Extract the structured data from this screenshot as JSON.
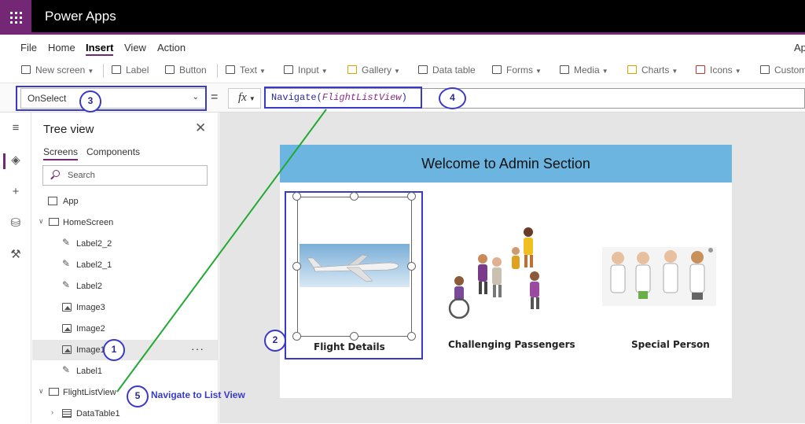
{
  "app": {
    "title": "Power Apps"
  },
  "menu": {
    "items": [
      "File",
      "Home",
      "Insert",
      "View",
      "Action"
    ],
    "active": "Insert",
    "right_label": "Ap"
  },
  "ribbon": {
    "new_screen": "New screen",
    "label": "Label",
    "button": "Button",
    "text": "Text",
    "input": "Input",
    "gallery": "Gallery",
    "data_table": "Data table",
    "forms": "Forms",
    "media": "Media",
    "charts": "Charts",
    "icons": "Icons",
    "custom": "Custom"
  },
  "formula_bar": {
    "property": "OnSelect",
    "equals": "=",
    "fx": "fx",
    "function_name": "Navigate",
    "function_arg": "FlightListView",
    "paren_open": "(",
    "paren_close": ")"
  },
  "tree_view": {
    "title": "Tree view",
    "tabs": [
      "Screens",
      "Components"
    ],
    "search_placeholder": "Search",
    "app_item": "App",
    "items": [
      {
        "label": "HomeScreen",
        "type": "screen"
      },
      {
        "label": "Label2_2",
        "type": "label"
      },
      {
        "label": "Label2_1",
        "type": "label"
      },
      {
        "label": "Label2",
        "type": "label"
      },
      {
        "label": "Image3",
        "type": "image"
      },
      {
        "label": "Image2",
        "type": "image"
      },
      {
        "label": "Image1",
        "type": "image",
        "selected": true
      },
      {
        "label": "Label1",
        "type": "label"
      },
      {
        "label": "FlightListView",
        "type": "screen"
      },
      {
        "label": "DataTable1",
        "type": "table"
      }
    ],
    "more": "···"
  },
  "canvas": {
    "header": "Welcome to Admin Section",
    "cards": [
      "Flight Details",
      "Challenging Passengers",
      "Special Person"
    ]
  },
  "annotations": {
    "n1": "1",
    "n2": "2",
    "n3": "3",
    "n4": "4",
    "n5": "5",
    "n5_text": "Navigate to List View"
  },
  "colors": {
    "brand": "#742774",
    "header_blue": "#6bb5e0",
    "annotation_blue": "#3a3ac8",
    "arrow_green": "#22aa33"
  }
}
